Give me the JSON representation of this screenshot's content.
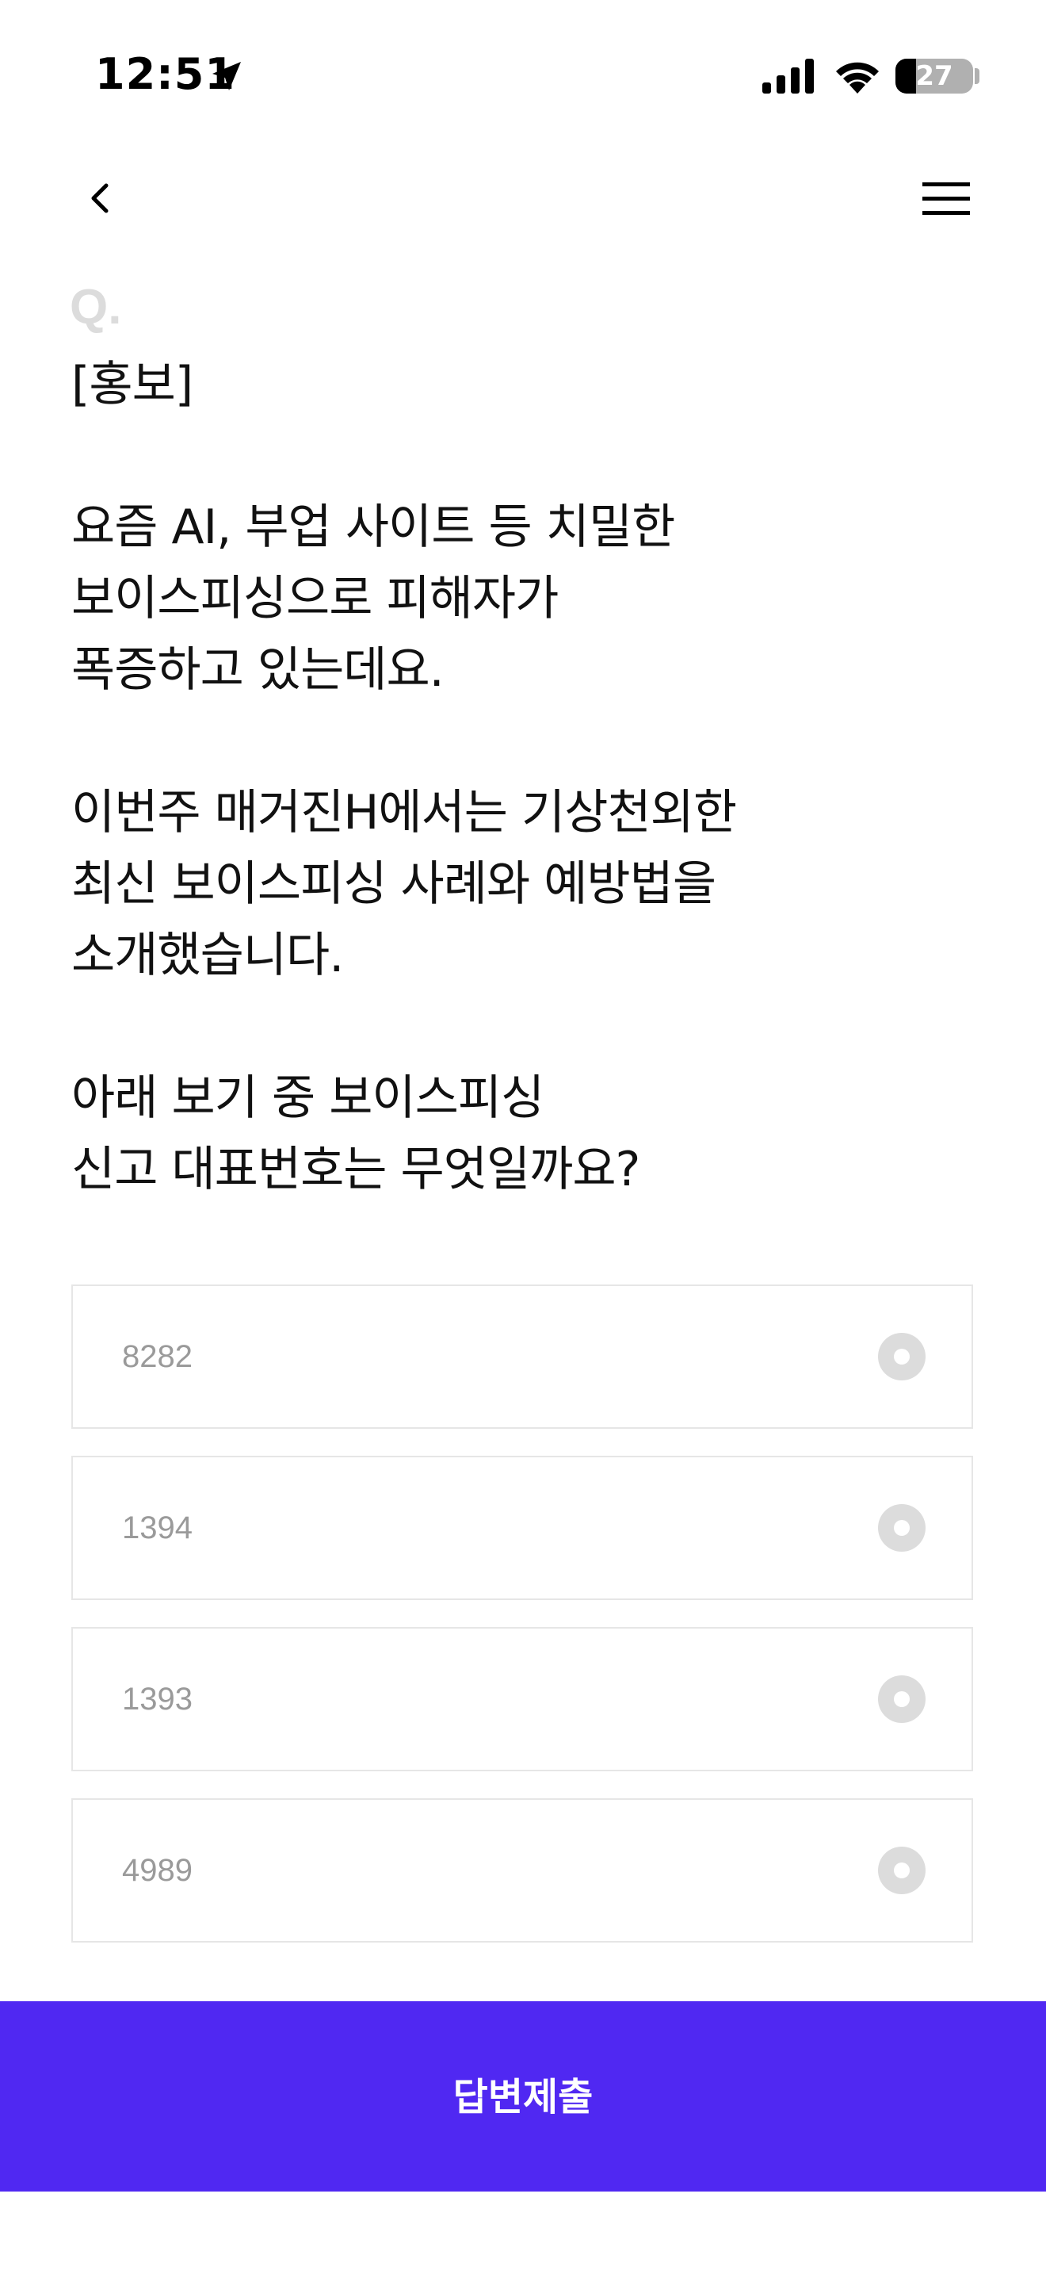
{
  "status_bar": {
    "time": "12:51",
    "battery": "27",
    "battery_level": 0.27
  },
  "nav": {
    "back_icon": "chevron-left-icon",
    "menu_icon": "hamburger-menu-icon"
  },
  "question": {
    "prefix": "Q.",
    "text": "[홍보]\n\n요즘 AI, 부업 사이트 등 치밀한\n보이스피싱으로 피해자가\n폭증하고 있는데요.\n\n이번주 매거진H에서는 기상천외한\n최신 보이스피싱 사례와 예방법을\n소개했습니다.\n\n아래 보기 중 보이스피싱\n신고 대표번호는 무엇일까요?"
  },
  "options": [
    {
      "label": "8282"
    },
    {
      "label": "1394"
    },
    {
      "label": "1393"
    },
    {
      "label": "4989"
    }
  ],
  "submit": {
    "label": "답변제출"
  },
  "colors": {
    "accent": "#5028f2",
    "option_border": "#e6e6e6",
    "option_text": "#9a9a9a",
    "radio": "#dcdcdc"
  }
}
